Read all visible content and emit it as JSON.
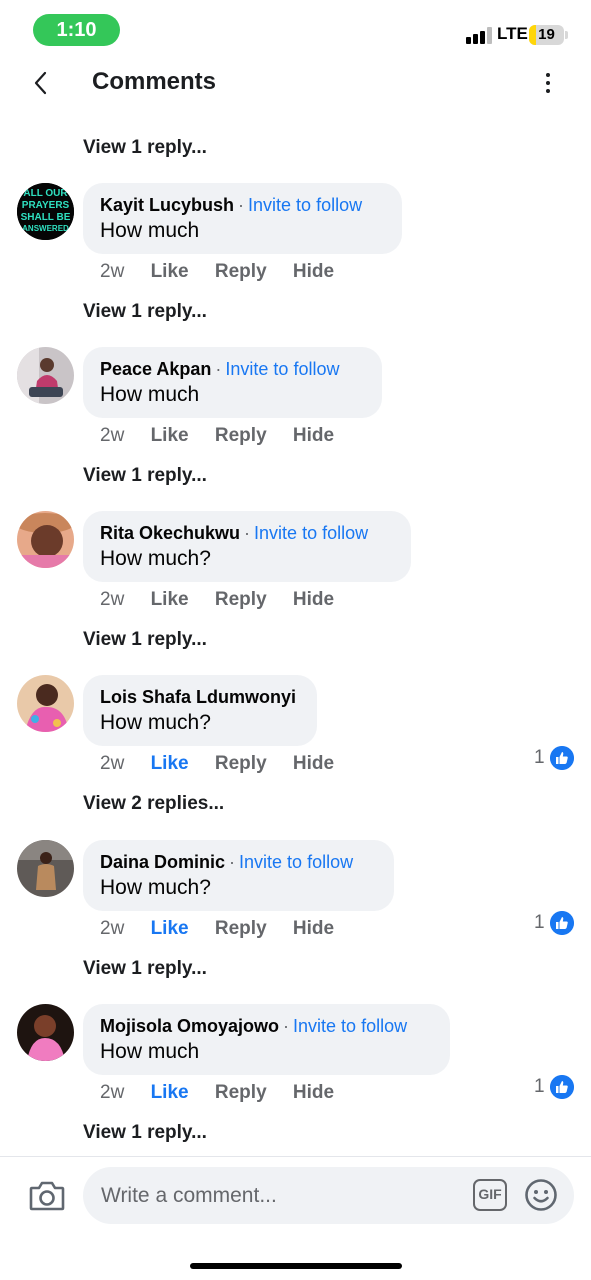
{
  "status_bar": {
    "time": "1:10",
    "network": "LTE",
    "battery": "19",
    "battery_level_percent": 19,
    "time_pill_color": "#34c759",
    "battery_color": "#ffd60a"
  },
  "header": {
    "title": "Comments",
    "back_icon": "chevron-left-icon",
    "more_icon": "more-vertical-icon"
  },
  "top_view_replies": "View 1 reply...",
  "comments": [
    {
      "author": "Kayit Lucybush",
      "separator": "·",
      "invite": "Invite to follow",
      "text": "How much",
      "time": "2w",
      "like": "Like",
      "reply": "Reply",
      "hide": "Hide",
      "liked": false,
      "reaction_count": "",
      "view_replies": "View 1 reply...",
      "avatar_text": [
        "ALL OUR",
        "PRAYERS",
        "SHALL BE",
        "ANSWERED"
      ]
    },
    {
      "author": "Peace Akpan",
      "separator": "·",
      "invite": "Invite to follow",
      "text": "How much",
      "time": "2w",
      "like": "Like",
      "reply": "Reply",
      "hide": "Hide",
      "liked": false,
      "reaction_count": "",
      "view_replies": "View 1 reply..."
    },
    {
      "author": "Rita Okechukwu",
      "separator": "·",
      "invite": "Invite to follow",
      "text": "How much?",
      "time": "2w",
      "like": "Like",
      "reply": "Reply",
      "hide": "Hide",
      "liked": false,
      "reaction_count": "",
      "view_replies": "View 1 reply..."
    },
    {
      "author": "Lois Shafa Ldumwonyi",
      "separator": "",
      "invite": "",
      "text": "How much?",
      "time": "2w",
      "like": "Like",
      "reply": "Reply",
      "hide": "Hide",
      "liked": true,
      "reaction_count": "1",
      "view_replies": "View 2 replies..."
    },
    {
      "author": "Daina Dominic",
      "separator": "·",
      "invite": "Invite to follow",
      "text": "How much?",
      "time": "2w",
      "like": "Like",
      "reply": "Reply",
      "hide": "Hide",
      "liked": true,
      "reaction_count": "1",
      "view_replies": "View 1 reply..."
    },
    {
      "author": "Mojisola Omoyajowo",
      "separator": "·",
      "invite": "Invite to follow",
      "text": "How much",
      "time": "2w",
      "like": "Like",
      "reply": "Reply",
      "hide": "Hide",
      "liked": true,
      "reaction_count": "1",
      "view_replies": "View 1 reply..."
    }
  ],
  "composer": {
    "placeholder": "Write a comment...",
    "gif_label": "GIF",
    "camera_icon": "camera-icon",
    "emoji_icon": "smiley-icon"
  },
  "colors": {
    "accent": "#1877f2",
    "bubble": "#f0f2f5",
    "secondary_text": "#65676b"
  }
}
